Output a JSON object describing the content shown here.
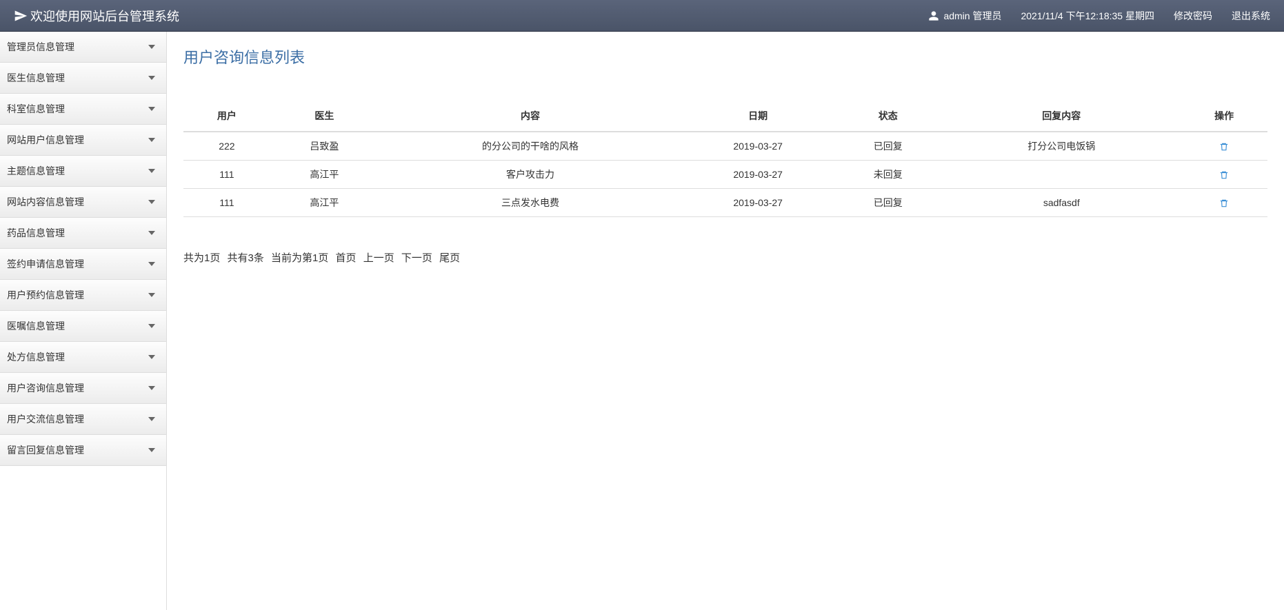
{
  "header": {
    "title": "欢迎使用网站后台管理系统",
    "user_label": "admin 管理员",
    "datetime": "2021/11/4 下午12:18:35 星期四",
    "change_password": "修改密码",
    "logout": "退出系统"
  },
  "sidebar": {
    "items": [
      {
        "label": "管理员信息管理"
      },
      {
        "label": "医生信息管理"
      },
      {
        "label": "科室信息管理"
      },
      {
        "label": "网站用户信息管理"
      },
      {
        "label": "主题信息管理"
      },
      {
        "label": "网站内容信息管理"
      },
      {
        "label": "药品信息管理"
      },
      {
        "label": "签约申请信息管理"
      },
      {
        "label": "用户预约信息管理"
      },
      {
        "label": "医嘱信息管理"
      },
      {
        "label": "处方信息管理"
      },
      {
        "label": "用户咨询信息管理"
      },
      {
        "label": "用户交流信息管理"
      },
      {
        "label": "留言回复信息管理"
      }
    ]
  },
  "main": {
    "page_title": "用户咨询信息列表",
    "columns": [
      "用户",
      "医生",
      "内容",
      "日期",
      "状态",
      "回复内容",
      "操作"
    ],
    "rows": [
      {
        "user": "222",
        "doctor": "吕致盈",
        "content": "的分公司的干啥的风格",
        "date": "2019-03-27",
        "status": "已回复",
        "reply": "打分公司电饭锅"
      },
      {
        "user": "111",
        "doctor": "高江平",
        "content": "客户攻击力",
        "date": "2019-03-27",
        "status": "未回复",
        "reply": ""
      },
      {
        "user": "111",
        "doctor": "高江平",
        "content": "三点发水电费",
        "date": "2019-03-27",
        "status": "已回复",
        "reply": "sadfasdf"
      }
    ],
    "pagination": {
      "summary_pages": "共为1页",
      "summary_count": "共有3条",
      "current": "当前为第1页",
      "first": "首页",
      "prev": "上一页",
      "next": "下一页",
      "last": "尾页"
    }
  }
}
